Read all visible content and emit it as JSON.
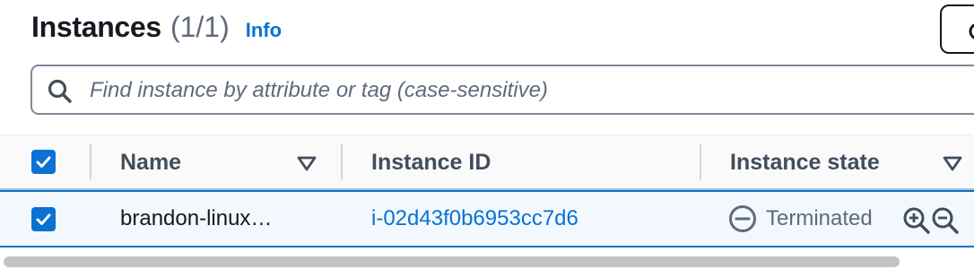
{
  "header": {
    "title": "Instances",
    "count": "(1/1)",
    "info_label": "Info"
  },
  "search": {
    "placeholder": "Find instance by attribute or tag (case-sensitive)",
    "value": ""
  },
  "table": {
    "columns": [
      {
        "label": "Name",
        "sortable": true
      },
      {
        "label": "Instance ID",
        "sortable": false
      },
      {
        "label": "Instance state",
        "sortable": true
      }
    ],
    "header_checkbox_checked": true,
    "rows": [
      {
        "selected": true,
        "name": "brandon-linux…",
        "instance_id": "i-02d43f0b6953cc7d6",
        "state": "Terminated",
        "state_icon": "minus-circle-icon"
      }
    ]
  },
  "colors": {
    "accent": "#0972d3",
    "row_selected_bg": "#f2f8fd",
    "text_primary": "#16191f",
    "text_secondary": "#5f6b7a"
  }
}
